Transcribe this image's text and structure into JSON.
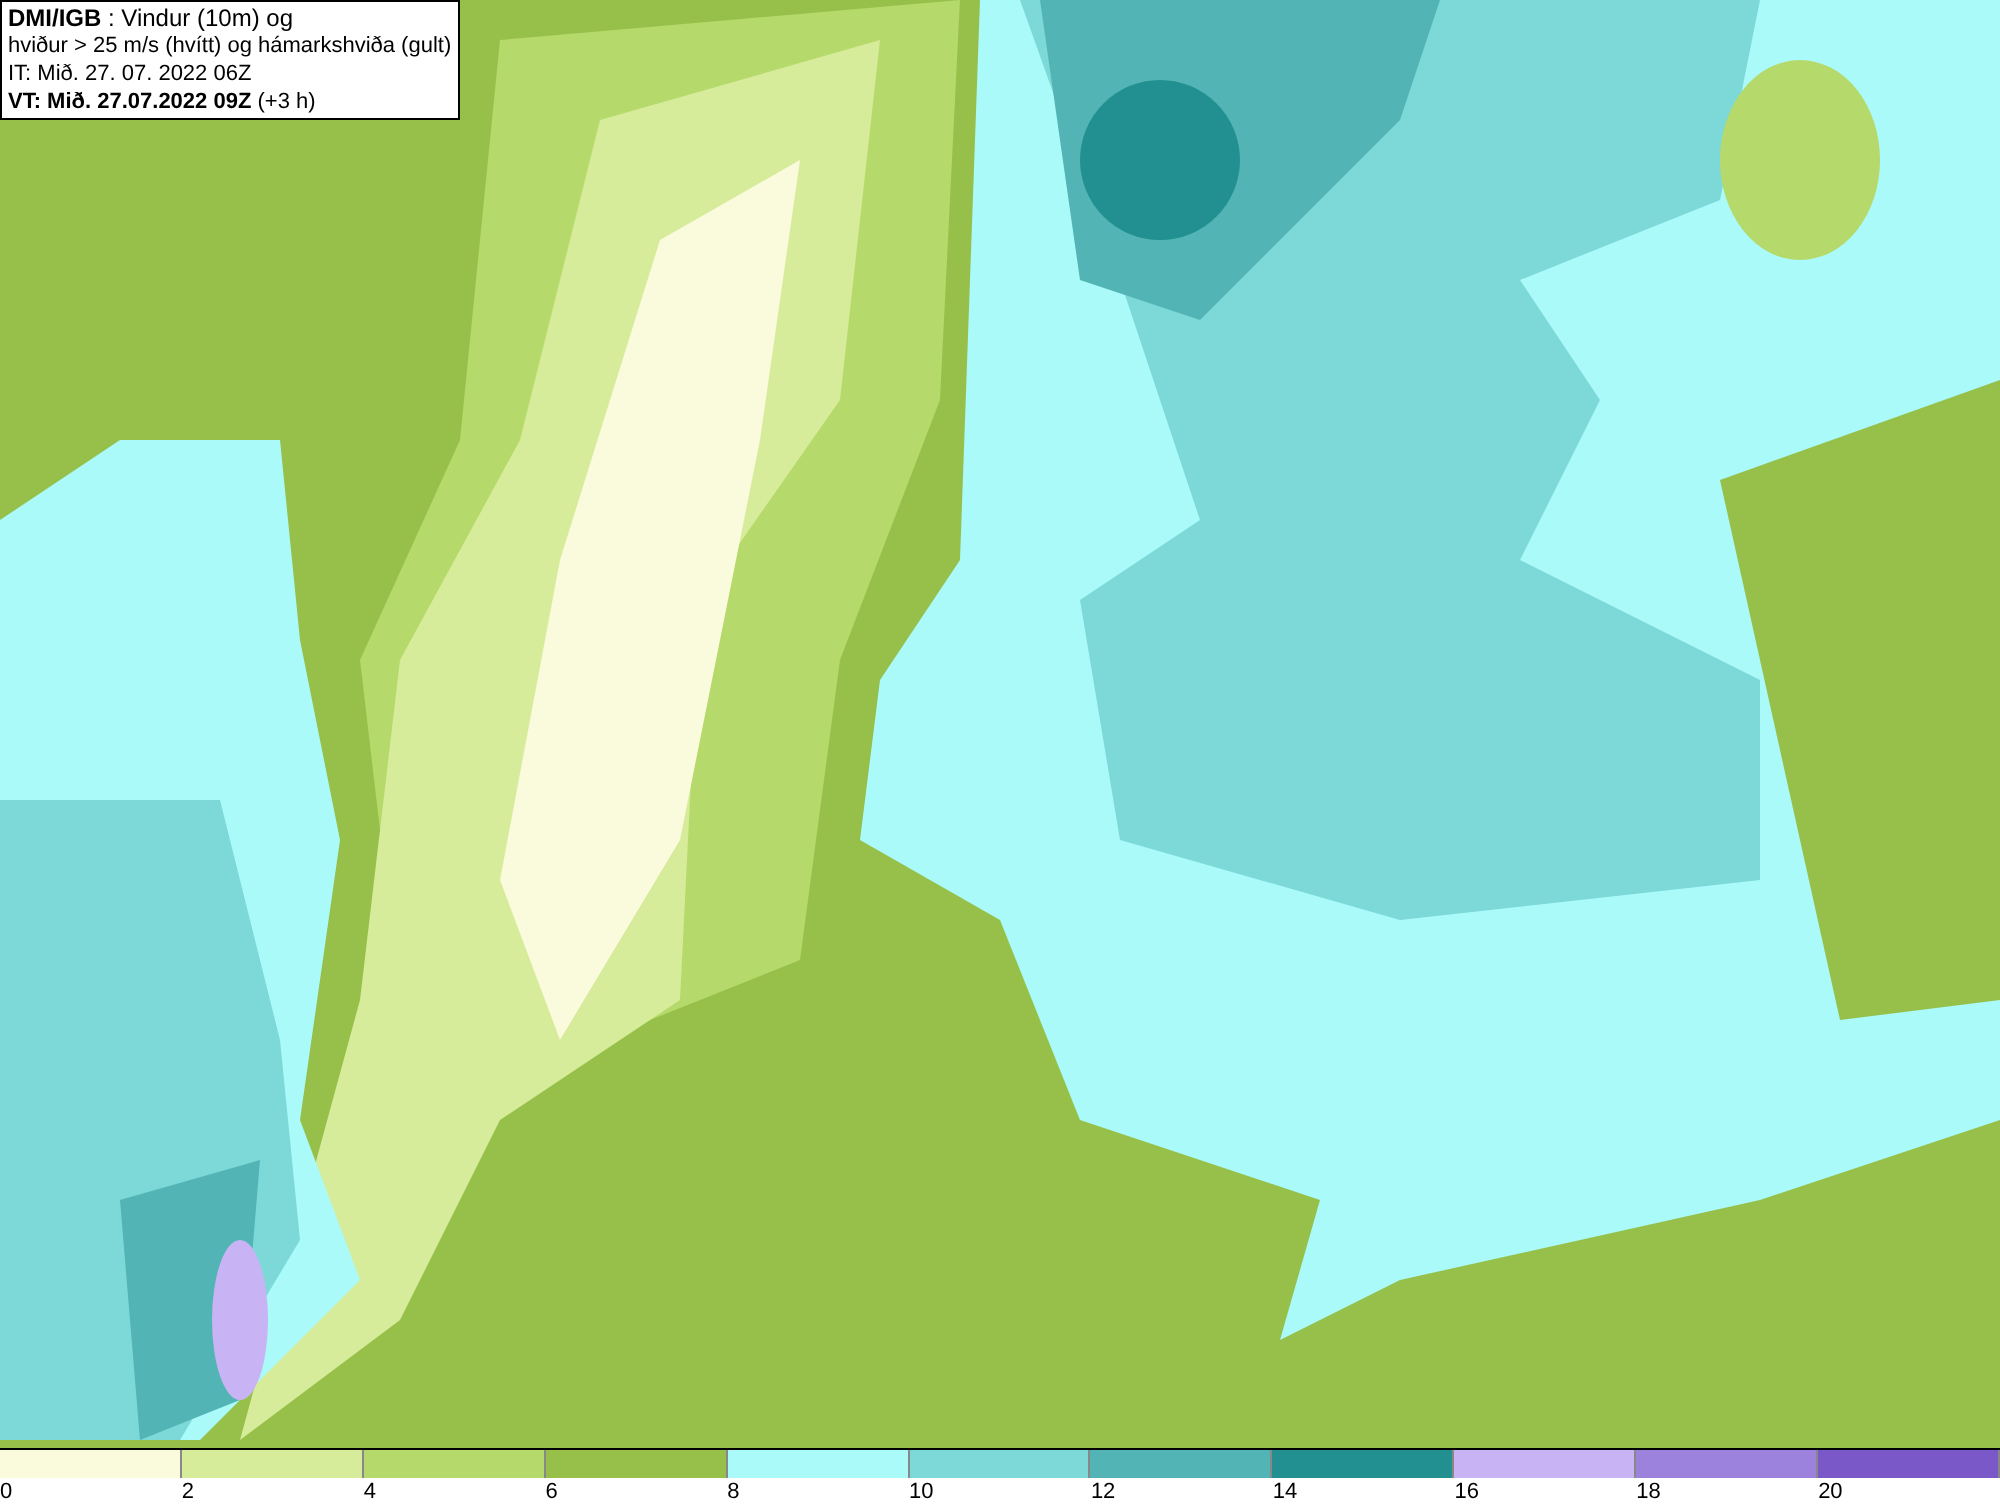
{
  "info_box": {
    "lines": [
      "**DMI/IGB** : Vindur (10m) og",
      "hviður > 25 m/s (hvítt) og hámarkshviða (gult)",
      "IT: Mið. 27. 07. 2022 06Z",
      "**VT: Mið. 27.07.2022 09Z** (+3 h)"
    ]
  },
  "legend": {
    "bins": [
      {
        "color": "#fafadc",
        "label": "0"
      },
      {
        "color": "#d6ec9a",
        "label": "2"
      },
      {
        "color": "#b5d96a",
        "label": "4"
      },
      {
        "color": "#96c04a",
        "label": "6"
      },
      {
        "color": "#aafafa",
        "label": "8"
      },
      {
        "color": "#7dd8d8",
        "label": "10"
      },
      {
        "color": "#52b4b4",
        "label": "12"
      },
      {
        "color": "#229090",
        "label": "14"
      },
      {
        "color": "#c8b4f4",
        "label": "16"
      },
      {
        "color": "#9c82dc",
        "label": "18"
      },
      {
        "color": "#7a58c8",
        "label": "20"
      }
    ]
  }
}
